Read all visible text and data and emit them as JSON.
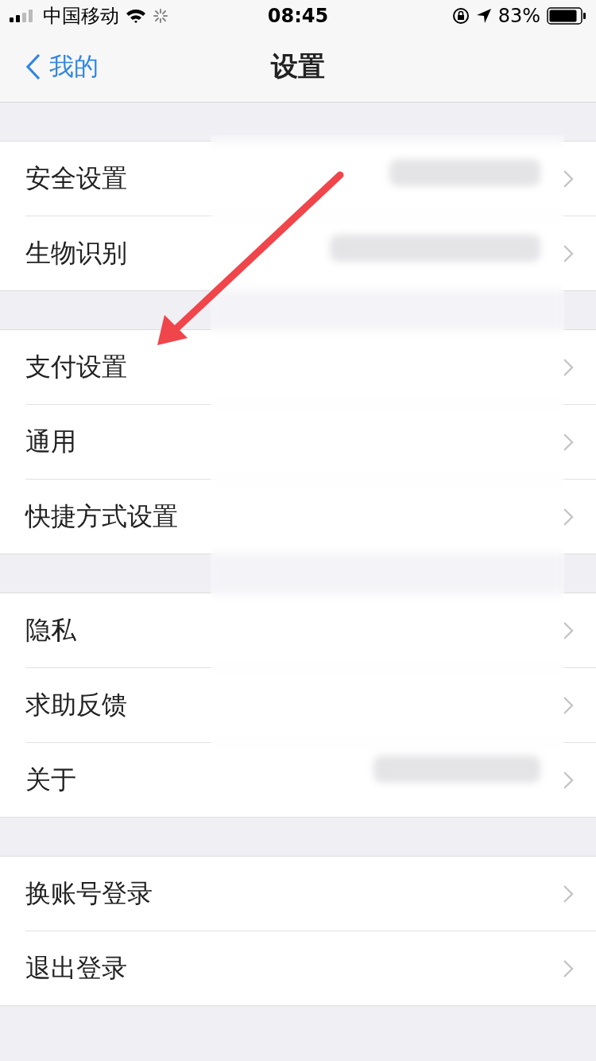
{
  "status_bar": {
    "carrier": "中国移动",
    "time": "08:45",
    "battery": "83%"
  },
  "nav": {
    "back": "我的",
    "title": "设置"
  },
  "groups": [
    {
      "items": [
        {
          "label": "安全设置"
        },
        {
          "label": "生物识别"
        }
      ]
    },
    {
      "items": [
        {
          "label": "支付设置"
        },
        {
          "label": "通用"
        },
        {
          "label": "快捷方式设置"
        }
      ]
    },
    {
      "items": [
        {
          "label": "隐私"
        },
        {
          "label": "求助反馈"
        },
        {
          "label": "关于"
        }
      ]
    },
    {
      "items": [
        {
          "label": "换账号登录"
        },
        {
          "label": "退出登录"
        }
      ]
    }
  ]
}
